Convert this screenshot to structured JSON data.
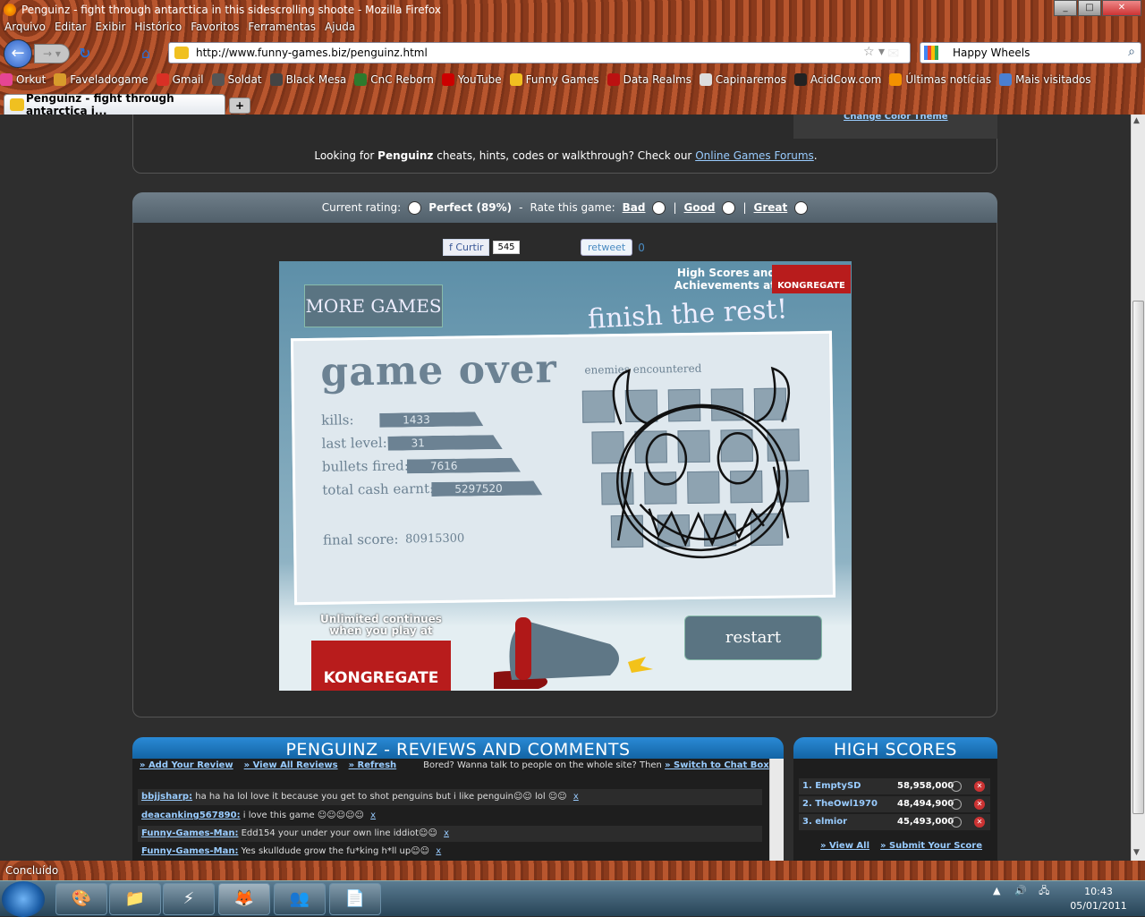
{
  "window": {
    "title": "Penguinz - fight through antarctica in this sidescrolling shoote - Mozilla Firefox"
  },
  "menu": [
    "Arquivo",
    "Editar",
    "Exibir",
    "Histórico",
    "Favoritos",
    "Ferramentas",
    "Ajuda"
  ],
  "nav": {
    "url": "http://www.funny-games.biz/penguinz.html",
    "search_value": "Happy Wheels"
  },
  "bookmarks": [
    {
      "label": "Orkut",
      "color": "#e64593"
    },
    {
      "label": "Faveladogame",
      "color": "#d89b2b"
    },
    {
      "label": "Gmail",
      "color": "#d93025"
    },
    {
      "label": "Soldat",
      "color": "#555"
    },
    {
      "label": "Black Mesa",
      "color": "#444"
    },
    {
      "label": "CnC Reborn",
      "color": "#2d7a2d"
    },
    {
      "label": "YouTube",
      "color": "#c00"
    },
    {
      "label": "Funny Games",
      "color": "#f0c020"
    },
    {
      "label": "Data Realms",
      "color": "#b11"
    },
    {
      "label": "Capinaremos",
      "color": "#ddd"
    },
    {
      "label": "AcidCow.com",
      "color": "#222"
    },
    {
      "label": "Últimas notícias",
      "color": "#f39200"
    },
    {
      "label": "Mais visitados",
      "color": "#4a7fd1"
    }
  ],
  "tab": {
    "label": "Penguinz - fight through antarctica i..."
  },
  "page": {
    "change_theme": "Change Color Theme",
    "cheats_text_1": "Looking for ",
    "cheats_game": "Penguinz",
    "cheats_text_2": " cheats, hints, codes or walkthrough? Check our ",
    "cheats_link": "Online Games Forums",
    "cheats_text_3": ".",
    "rating": {
      "label": "Current rating:",
      "value": "Perfect (89%)",
      "sep": "-",
      "rate_label": "Rate this game:",
      "bad": "Bad",
      "good": "Good",
      "great": "Great",
      "pipe": "|"
    },
    "social": {
      "fb_label": "Curtir",
      "fb_count": "545",
      "tw_label": "retweet",
      "tw_count": "0"
    }
  },
  "game": {
    "more_games": "MORE GAMES",
    "kong_top": "High Scores and Achievements at",
    "kong_name": "KONGREGATE",
    "finish": "finish the rest!",
    "game_over": "game over",
    "stats": [
      {
        "label": "kills:",
        "value": "1433"
      },
      {
        "label": "last level:",
        "value": "31"
      },
      {
        "label": "bullets fired:",
        "value": "7616"
      },
      {
        "label": "total cash earnt:",
        "value": "5297520"
      }
    ],
    "final_label": "final score:",
    "final_value": "80915300",
    "enemies_label": "enemies encountered",
    "unlimited": "Unlimited continues when you play at",
    "restart": "restart"
  },
  "reviews": {
    "title": "PENGUINZ - REVIEWS AND COMMENTS",
    "add": "» Add Your Review",
    "view": "» View All Reviews",
    "refresh": "» Refresh",
    "chat_text": "Bored? Wanna talk to people on the whole site? Then ",
    "chat_link": "» Switch to Chat Box",
    "comments": [
      {
        "user": "bbjjsharp:",
        "text": " ha ha ha lol love it because you get to shot penguins but i like penguin☺☺ lol ☺☺ ",
        "x": "x"
      },
      {
        "user": "deacanking567890:",
        "text": " i love this game ☺☺☺☺☺ ",
        "x": "x"
      },
      {
        "user": "Funny-Games-Man:",
        "text": " Edd154 your under your own line iddiot☺☺ ",
        "x": "x"
      },
      {
        "user": "Funny-Games-Man:",
        "text": " Yes skulldude grow the fu*king h*ll up☺☺ ",
        "x": "x"
      }
    ]
  },
  "highscores": {
    "title": "HIGH SCORES",
    "rows": [
      {
        "name": "1. EmptySD",
        "score": "58,958,000"
      },
      {
        "name": "2. TheOwl1970",
        "score": "48,494,900"
      },
      {
        "name": "3. elmior",
        "score": "45,493,000"
      }
    ],
    "view_all": "» View All",
    "submit": "» Submit Your Score"
  },
  "status": "Concluído",
  "clock": {
    "time": "10:43",
    "date": "05/01/2011"
  }
}
